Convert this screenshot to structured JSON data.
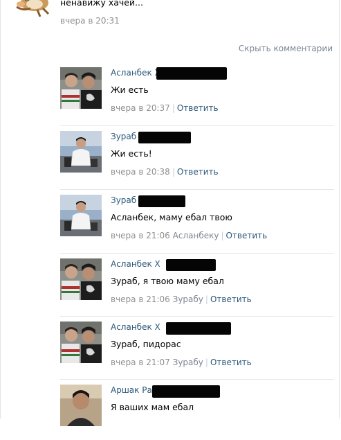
{
  "post": {
    "text": "ненавижу хачей...",
    "date": "вчера в 20:31",
    "avatar_icon": "cartoon-character-icon"
  },
  "hide_comments_label": "Скрыть комментарии",
  "comments": [
    {
      "author": "Асланбек Х",
      "text": "Жи есть",
      "date": "вчера в 20:37",
      "reply_to": "",
      "reply_label": "Ответить",
      "avatar": "two-men-photo"
    },
    {
      "author": "Зураб",
      "text": "Жи есть!",
      "date": "вчера в 20:38",
      "reply_to": "",
      "reply_label": "Ответить",
      "avatar": "man-sitting-photo"
    },
    {
      "author": "Зураб",
      "text": "Асланбек, маму ебал твою",
      "date": "вчера в 21:06",
      "reply_to": "Асланбеку",
      "reply_label": "Ответить",
      "avatar": "man-sitting-photo"
    },
    {
      "author": "Асланбек Х",
      "text": "Зураб, я твою маму ебал",
      "date": "вчера в 21:06",
      "reply_to": "Зурабу",
      "reply_label": "Ответить",
      "avatar": "two-men-photo"
    },
    {
      "author": "Асланбек Х",
      "text": "Зураб, пидорас",
      "date": "вчера в 21:07",
      "reply_to": "Зурабу",
      "reply_label": "Ответить",
      "avatar": "two-men-photo"
    },
    {
      "author": "Аршак Ра",
      "text": "Я ваших мам ебал",
      "date": "",
      "reply_to": "",
      "reply_label": "",
      "avatar": "man-portrait-photo"
    }
  ],
  "colors": {
    "link": "#2b587a",
    "meta_gray": "#909090",
    "separator": "#e4e8ed",
    "redaction": "#050505"
  }
}
